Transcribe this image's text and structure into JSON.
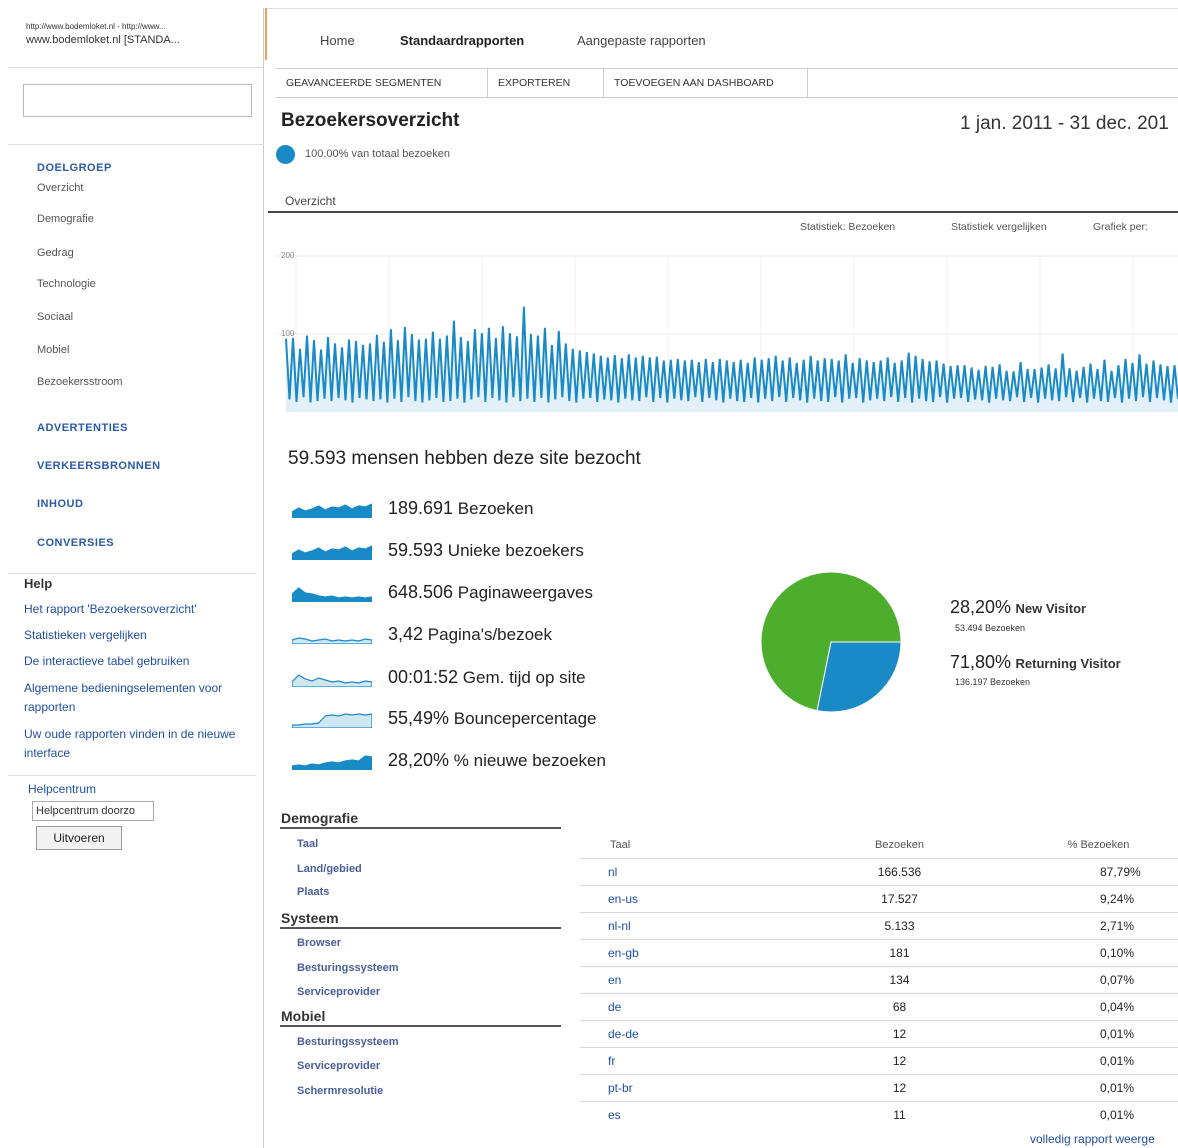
{
  "browser": {
    "tab_url": "http://www.bodemloket.nl - http://www...",
    "tab_title": "www.bodemloket.nl [STANDA..."
  },
  "nav": {
    "items": [
      "Home",
      "Standaardrapporten",
      "Aangepaste rapporten"
    ],
    "active": "Standaardrapporten"
  },
  "toolbar": {
    "buttons": [
      "GEAVANCEERDE SEGMENTEN",
      "EXPORTEREN",
      "TOEVOEGEN AAN DASHBOARD"
    ]
  },
  "sidebar": {
    "sections": [
      {
        "label": "DOELGROEP",
        "items": [
          "Overzicht",
          "Demografie",
          "Gedrag",
          "Technologie",
          "Sociaal",
          "Mobiel",
          "Bezoekersstroom"
        ]
      },
      {
        "label": "ADVERTENTIES",
        "items": []
      },
      {
        "label": "VERKEERSBRONNEN",
        "items": []
      },
      {
        "label": "INHOUD",
        "items": []
      },
      {
        "label": "CONVERSIES",
        "items": []
      }
    ],
    "help_title": "Help",
    "help_links": [
      "Het rapport 'Bezoekersoverzicht'",
      "Statistieken vergelijken",
      "De interactieve tabel gebruiken",
      "Algemene bedieningselementen voor rapporten",
      "Uw oude rapporten vinden in de nieuwe interface"
    ],
    "helpcentrum_label": "Helpcentrum",
    "helpcentrum_value": "Helpcentrum doorzo",
    "submit_label": "Uitvoeren"
  },
  "report": {
    "title": "Bezoekersoverzicht",
    "date_range": "1 jan. 2011 - 31 dec. 201",
    "segment_text": "100,00% van totaal bezoeken",
    "tab": "Overzicht",
    "chart_controls": [
      "Statistiek: Bezoeken",
      "Statistiek vergelijken",
      "Grafiek per:"
    ]
  },
  "chart_data": {
    "type": "line",
    "title": "",
    "ylabel": "",
    "ytick_top": "200",
    "ytick_mid": "100",
    "ylim": [
      0,
      200
    ],
    "series": [
      {
        "values": [
          94,
          16,
          95,
          13,
          81,
          19,
          98,
          12,
          92,
          14,
          80,
          17,
          96,
          14,
          88,
          18,
          83,
          15,
          93,
          12,
          91,
          18,
          86,
          16,
          88,
          14,
          99,
          16,
          90,
          12,
          106,
          17,
          92,
          13,
          109,
          19,
          100,
          14,
          93,
          12,
          94,
          15,
          103,
          18,
          94,
          13,
          98,
          14,
          117,
          17,
          96,
          12,
          91,
          16,
          106,
          19,
          101,
          13,
          108,
          18,
          95,
          15,
          110,
          12,
          101,
          19,
          97,
          14,
          135,
          17,
          100,
          13,
          98,
          18,
          108,
          12,
          86,
          16,
          104,
          19,
          88,
          14,
          81,
          12,
          79,
          17,
          77,
          18,
          75,
          13,
          72,
          16,
          70,
          15,
          73,
          12,
          69,
          17,
          74,
          15,
          70,
          14,
          72,
          19,
          70,
          13,
          71,
          18,
          66,
          12,
          67,
          17,
          68,
          15,
          66,
          14,
          67,
          19,
          64,
          13,
          68,
          18,
          64,
          15,
          68,
          12,
          66,
          17,
          64,
          14,
          67,
          13,
          63,
          18,
          70,
          12,
          67,
          17,
          69,
          14,
          72,
          19,
          66,
          13,
          70,
          18,
          63,
          15,
          67,
          12,
          72,
          17,
          66,
          14,
          69,
          13,
          68,
          19,
          66,
          12,
          74,
          17,
          63,
          18,
          69,
          12,
          66,
          15,
          64,
          17,
          66,
          14,
          70,
          19,
          63,
          13,
          66,
          18,
          76,
          12,
          72,
          17,
          68,
          14,
          65,
          13,
          66,
          19,
          62,
          12,
          59,
          17,
          60,
          18,
          60,
          13,
          57,
          16,
          54,
          15,
          59,
          12,
          58,
          17,
          61,
          15,
          53,
          14,
          52,
          19,
          64,
          13,
          55,
          18,
          55,
          12,
          57,
          17,
          61,
          15,
          56,
          14,
          75,
          19,
          56,
          13,
          53,
          18,
          58,
          12,
          62,
          17,
          55,
          14,
          67,
          13,
          53,
          18,
          60,
          12,
          68,
          17,
          63,
          14,
          74,
          19,
          62,
          13,
          66,
          18,
          61,
          15,
          59,
          12,
          60,
          17
        ]
      }
    ]
  },
  "summary": {
    "headline": "59.593 mensen hebben deze site bezocht",
    "metrics": [
      {
        "value": "189.691",
        "label": "Bezoeken"
      },
      {
        "value": "59.593",
        "label": "Unieke bezoekers"
      },
      {
        "value": "648.506",
        "label": "Paginaweergaves"
      },
      {
        "value": "3,42",
        "label": "Pagina's/bezoek"
      },
      {
        "value": "00:01:52",
        "label": "Gem. tijd op site"
      },
      {
        "value": "55,49%",
        "label": "Bouncepercentage"
      },
      {
        "value": "28,20%",
        "label": "% nieuwe bezoeken"
      }
    ]
  },
  "pie": {
    "slices": [
      {
        "name": "New Visitor",
        "percent_label": "28,20%",
        "percent": 28.2,
        "count": "53.494 Bezoeken",
        "color": "#1a8ac6"
      },
      {
        "name": "Returning Visitor",
        "percent_label": "71,80%",
        "percent": 71.8,
        "count": "136.197 Bezoeken",
        "color": "#4cae2c"
      }
    ]
  },
  "categories": [
    {
      "title": "Demografie",
      "items": [
        "Taal",
        "Land/gebied",
        "Plaats"
      ]
    },
    {
      "title": "Systeem",
      "items": [
        "Browser",
        "Besturingssysteem",
        "Serviceprovider"
      ]
    },
    {
      "title": "Mobiel",
      "items": [
        "Besturingssysteem",
        "Serviceprovider",
        "Schermresolutie"
      ]
    }
  ],
  "table": {
    "headers": [
      "Taal",
      "Bezoeken",
      "% Bezoeken"
    ],
    "rows": [
      [
        "nl",
        "166.536",
        "87,79%"
      ],
      [
        "en-us",
        "17.527",
        "9,24%"
      ],
      [
        "nl-nl",
        "5.133",
        "2,71%"
      ],
      [
        "en-gb",
        "181",
        "0,10%"
      ],
      [
        "en",
        "134",
        "0,07%"
      ],
      [
        "de",
        "68",
        "0,04%"
      ],
      [
        "de-de",
        "12",
        "0,01%"
      ],
      [
        "fr",
        "12",
        "0,01%"
      ],
      [
        "pt-br",
        "12",
        "0,01%"
      ],
      [
        "es",
        "11",
        "0,01%"
      ]
    ],
    "footer_link": "volledig rapport weerge"
  },
  "colors": {
    "accent": "#1a8ac6",
    "link": "#1f4fa3",
    "returning": "#4cae2c",
    "header_line": "#f0a060"
  }
}
